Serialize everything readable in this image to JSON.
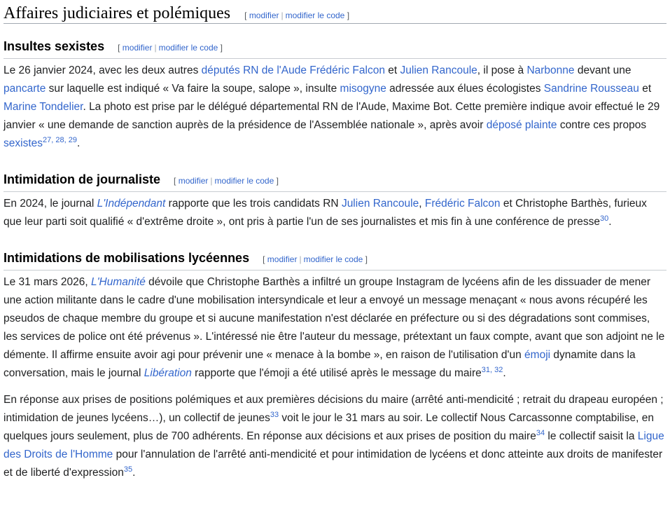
{
  "h2": {
    "title": "Affaires judiciaires et polémiques"
  },
  "edit": {
    "open": "[",
    "modifier": "modifier",
    "sep": "|",
    "modifier_code": "modifier le code",
    "close": "]"
  },
  "s1": {
    "title": "Insultes sexistes",
    "t1": "Le 26 janvier 2024, avec les deux autres ",
    "l1": "députés RN de l'Aude",
    "t2": " ",
    "l2": "Frédéric Falcon",
    "t3": " et ",
    "l3": "Julien Rancoule",
    "t4": ", il pose à ",
    "l4": "Narbonne",
    "t5": " devant une ",
    "l5": "pancarte",
    "t6": " sur laquelle est indiqué « Va faire la soupe, salope », insulte ",
    "l6": "misogyne",
    "t7": " adressée aux élues écologistes ",
    "l7": "Sandrine Rousseau",
    "t8": " et ",
    "l8": "Marine Tondelier",
    "t9": ". La photo est prise par le délégué départemental RN de l'Aude, Maxime Bot. Cette première indique avoir effectué le 29 janvier « une demande de sanction auprès de la présidence de l'Assemblée nationale », après avoir ",
    "l9": "déposé plainte",
    "t10": " contre ces propos ",
    "l10": "sexistes",
    "ref": "27, 28, 29",
    "end": "."
  },
  "s2": {
    "title": "Intimidation de journaliste",
    "t1": "En 2024, le journal ",
    "l1": "L'Indépendant",
    "t2": " rapporte que les trois candidats RN ",
    "l2": "Julien Rancoule",
    "t3": ", ",
    "l3": "Frédéric Falcon",
    "t4": " et Christophe Barthès, furieux que leur parti soit qualifié « d'extrême droite », ont pris à partie l'un de ses journalistes et mis fin à une conférence de presse",
    "ref": "30",
    "end": "."
  },
  "s3": {
    "title": "Intimidations de mobilisations lycéennes",
    "p1": {
      "t1": "Le 31 mars 2026, ",
      "l1": "L'Humanité",
      "t2": " dévoile que Christophe Barthès a infiltré un groupe Instagram de lycéens afin de les dissuader de mener une action militante dans le cadre d'une mobilisation intersyndicale et leur a envoyé un message menaçant « nous avons récupéré les pseudos de chaque membre du groupe et si aucune manifestation n'est déclarée en préfecture ou si des dégradations sont commises, les services de police ont été prévenus ». L'intéressé nie être l'auteur du message, prétextant un faux compte, avant que son adjoint ne le démente. Il affirme ensuite avoir agi pour prévenir une « menace à la bombe », en raison de l'utilisation d'un ",
      "l2": "émoji",
      "t3": " dynamite dans la conversation, mais le journal ",
      "l3": "Libération",
      "t4": " rapporte que l'émoji a été utilisé après le message du maire",
      "ref": "31, 32",
      "end": "."
    },
    "p2": {
      "t1": "En réponse aux prises de positions polémiques et aux premières décisions du maire (arrêté anti-mendicité ; retrait du drapeau européen ; intimidation de jeunes lycéens…), un collectif de jeunes",
      "ref1": "33",
      "t2": " voit le jour le 31 mars au soir. Le collectif Nous Carcassonne comptabilise, en quelques jours seulement, plus de 700 adhérents. En réponse aux décisions et aux prises de position du maire",
      "ref2": "34",
      "t3": " le collectif saisit la ",
      "l1": "Ligue des Droits de l'Homme",
      "t4": " pour l'annulation de l'arrêté anti-mendicité et pour intimidation de lycéens et donc atteinte aux droits de manifester et de liberté d'expression",
      "ref3": "35",
      "end": "."
    }
  }
}
